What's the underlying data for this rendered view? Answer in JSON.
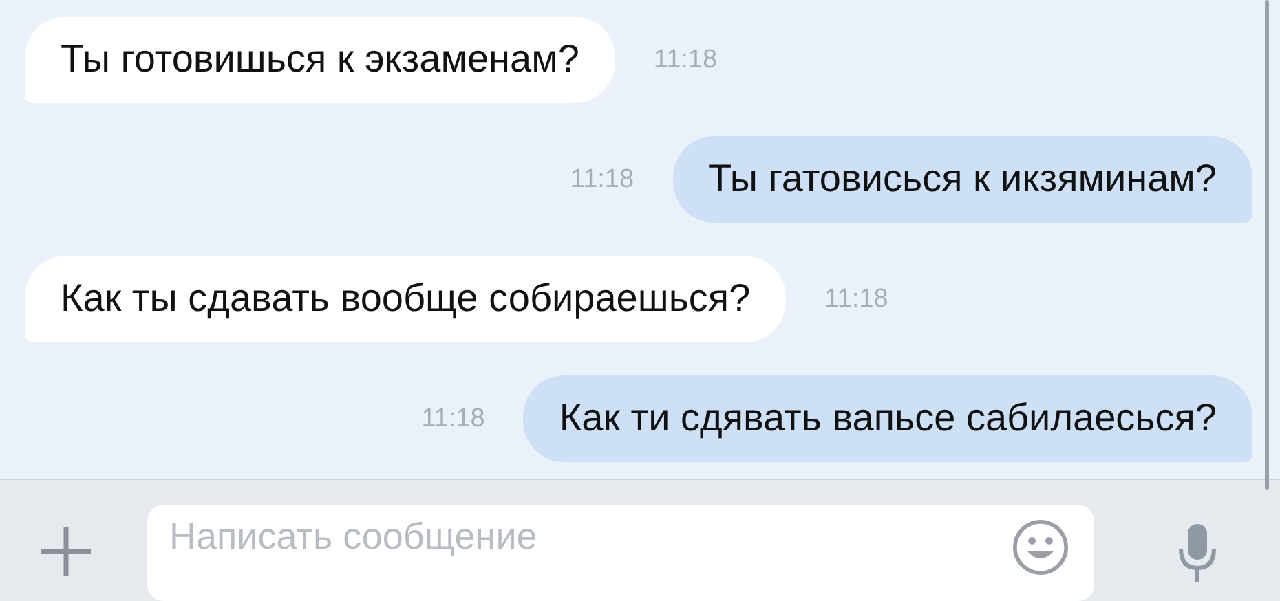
{
  "messages": [
    {
      "text": "Ты готовишься к экзаменам?",
      "time": "11:18",
      "outgoing": false
    },
    {
      "text": "Ты гатовисься к икзяминам?",
      "time": "11:18",
      "outgoing": true
    },
    {
      "text": "Как ты сдавать вообще собираешься?",
      "time": "11:18",
      "outgoing": false
    },
    {
      "text": "Как ти сдявать вапьсе сабилаесься?",
      "time": "11:18",
      "outgoing": true
    }
  ],
  "composer": {
    "placeholder": "Написать сообщение"
  }
}
